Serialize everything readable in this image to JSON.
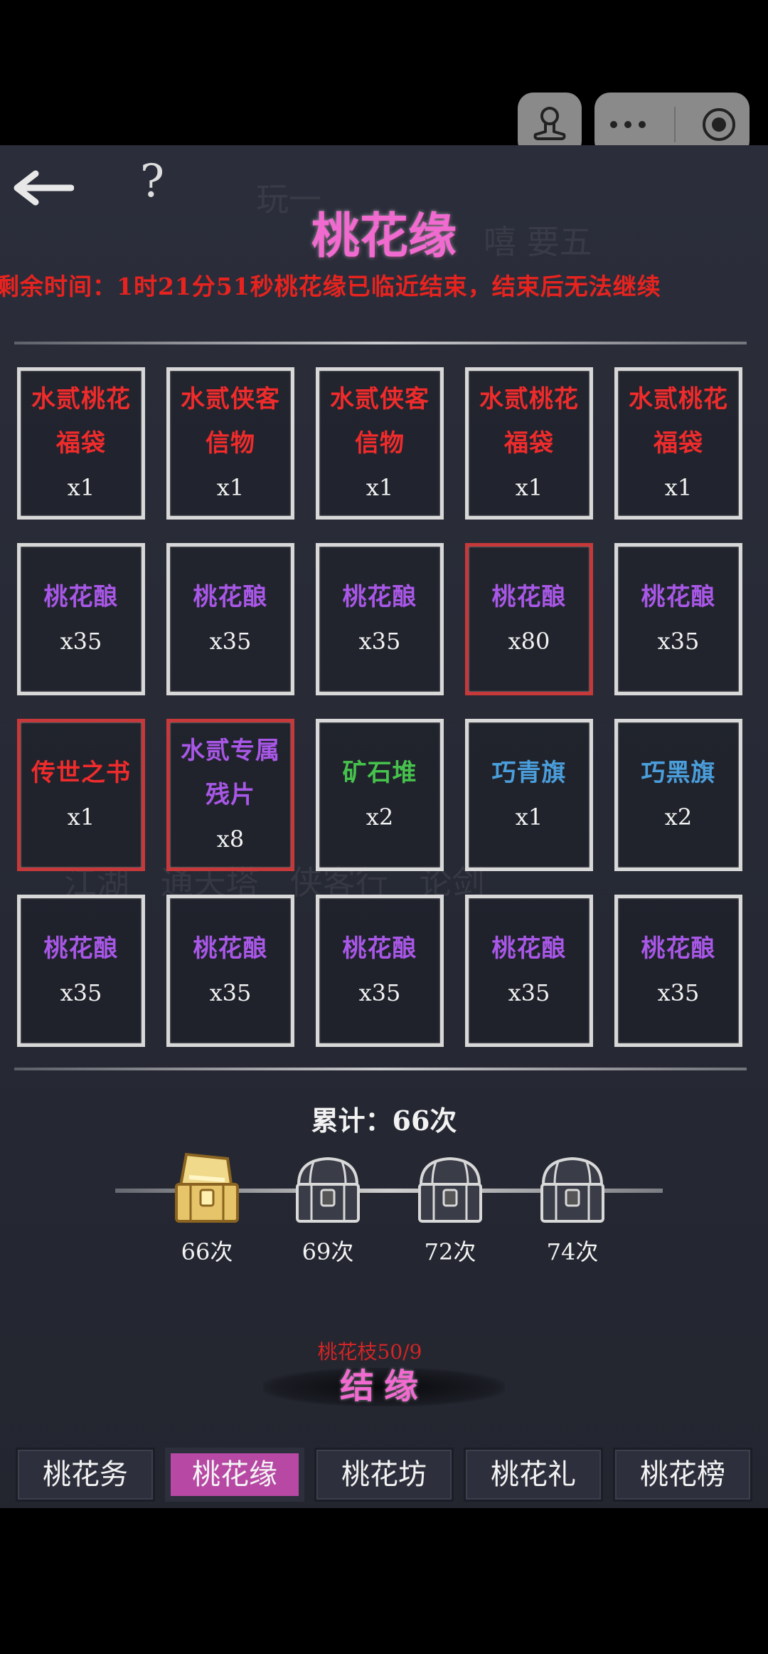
{
  "header": {
    "help_glyph": "?",
    "title": "桃花缘",
    "notice": "剩余时间：1时21分51秒桃花缘已临近结束，结束后无法继续"
  },
  "colors": {
    "title": "#f06ad0",
    "red_item": "#ef2b2b",
    "purple_item": "#a857e6",
    "green_item": "#46c24c",
    "blue_item": "#4a9edb",
    "rare_border": "#c7383a",
    "active_tab": "#b748a4"
  },
  "grid": {
    "items": [
      {
        "name1": "水贰桃花",
        "name2": "福袋",
        "qty": "x1",
        "color": "#ef2b2b",
        "rare": false
      },
      {
        "name1": "水贰侠客",
        "name2": "信物",
        "qty": "x1",
        "color": "#ef2b2b",
        "rare": false
      },
      {
        "name1": "水贰侠客",
        "name2": "信物",
        "qty": "x1",
        "color": "#ef2b2b",
        "rare": false
      },
      {
        "name1": "水贰桃花",
        "name2": "福袋",
        "qty": "x1",
        "color": "#ef2b2b",
        "rare": false
      },
      {
        "name1": "水贰桃花",
        "name2": "福袋",
        "qty": "x1",
        "color": "#ef2b2b",
        "rare": false
      },
      {
        "name1": "桃花酿",
        "name2": "",
        "qty": "x35",
        "color": "#a857e6",
        "rare": false
      },
      {
        "name1": "桃花酿",
        "name2": "",
        "qty": "x35",
        "color": "#a857e6",
        "rare": false
      },
      {
        "name1": "桃花酿",
        "name2": "",
        "qty": "x35",
        "color": "#a857e6",
        "rare": false
      },
      {
        "name1": "桃花酿",
        "name2": "",
        "qty": "x80",
        "color": "#a857e6",
        "rare": true
      },
      {
        "name1": "桃花酿",
        "name2": "",
        "qty": "x35",
        "color": "#a857e6",
        "rare": false
      },
      {
        "name1": "传世之书",
        "name2": "",
        "qty": "x1",
        "color": "#ef2b2b",
        "rare": true
      },
      {
        "name1": "水贰专属",
        "name2": "残片",
        "qty": "x8",
        "color": "#a857e6",
        "rare": true
      },
      {
        "name1": "矿石堆",
        "name2": "",
        "qty": "x2",
        "color": "#46c24c",
        "rare": false
      },
      {
        "name1": "巧青旗",
        "name2": "",
        "qty": "x1",
        "color": "#4a9edb",
        "rare": false
      },
      {
        "name1": "巧黑旗",
        "name2": "",
        "qty": "x2",
        "color": "#4a9edb",
        "rare": false
      },
      {
        "name1": "桃花酿",
        "name2": "",
        "qty": "x35",
        "color": "#a857e6",
        "rare": false
      },
      {
        "name1": "桃花酿",
        "name2": "",
        "qty": "x35",
        "color": "#a857e6",
        "rare": false
      },
      {
        "name1": "桃花酿",
        "name2": "",
        "qty": "x35",
        "color": "#a857e6",
        "rare": false
      },
      {
        "name1": "桃花酿",
        "name2": "",
        "qty": "x35",
        "color": "#a857e6",
        "rare": false
      },
      {
        "name1": "桃花酿",
        "name2": "",
        "qty": "x35",
        "color": "#a857e6",
        "rare": false
      }
    ]
  },
  "progress": {
    "counter": "累计：66次",
    "milestones": [
      {
        "label": "66次",
        "opened": true
      },
      {
        "label": "69次",
        "opened": false
      },
      {
        "label": "72次",
        "opened": false
      },
      {
        "label": "74次",
        "opened": false
      }
    ]
  },
  "action": {
    "branch_count": "桃花枝50/9",
    "bind_label": "结缘"
  },
  "tabs": [
    {
      "label": "桃花务",
      "active": false
    },
    {
      "label": "桃花缘",
      "active": true
    },
    {
      "label": "桃花坊",
      "active": false
    },
    {
      "label": "桃花礼",
      "active": false
    },
    {
      "label": "桃花榜",
      "active": false
    }
  ],
  "icons": [
    "back-arrow-icon",
    "help-icon",
    "mini-program-person-icon",
    "more-dots-icon",
    "close-target-icon",
    "treasure-chest-icon"
  ]
}
